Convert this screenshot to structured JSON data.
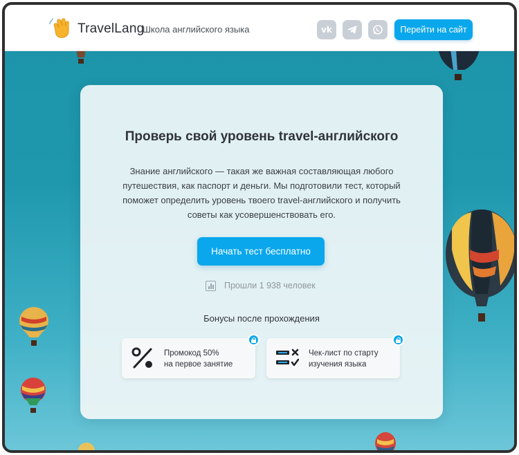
{
  "header": {
    "logo_emoji": "👋",
    "logo_text": "TravelLang",
    "tagline": "Школа английского языка",
    "social": [
      {
        "name": "vk-icon",
        "label": "vk"
      },
      {
        "name": "telegram-icon",
        "label": ""
      },
      {
        "name": "whatsapp-icon",
        "label": ""
      }
    ],
    "cta_label": "Перейти на сайт"
  },
  "card": {
    "title": "Проверь свой уровень travel-английского",
    "text": "Знание английского — такая же важная составляющая любого путешествия, как паспорт и деньги. Мы подготовили тест, который поможет определить уровень твоего travel-английского и получить советы как усовершенствовать его.",
    "start_label": "Начать тест бесплатно",
    "passed_text": "Прошли 1 938 человек",
    "bonus_title": "Бонусы после прохождения",
    "bonuses": [
      {
        "line1": "Промокод 50%",
        "line2": "на первое занятие",
        "icon": "percent-icon"
      },
      {
        "line1": "Чек-лист по старту",
        "line2": "изучения языка",
        "icon": "checklist-icon"
      }
    ]
  },
  "colors": {
    "accent": "#0aa7ec",
    "sky": "#1f98ad",
    "card_bg": "#f0f6f8"
  }
}
